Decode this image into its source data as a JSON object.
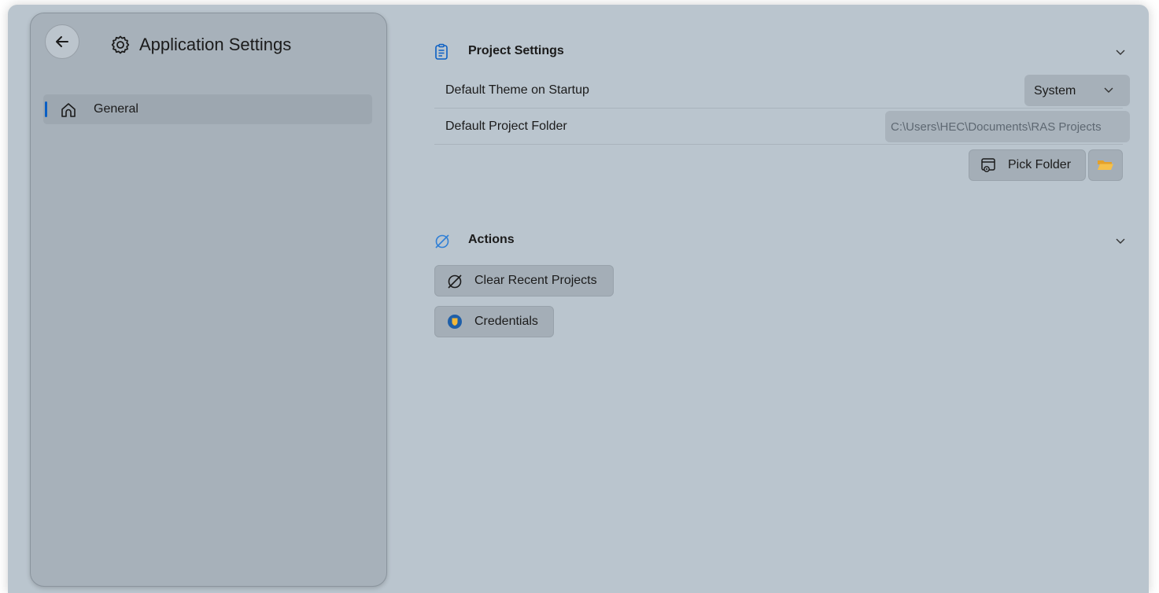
{
  "sidebar": {
    "title": "Application Settings",
    "items": [
      {
        "label": "General",
        "icon": "home-icon",
        "selected": true
      }
    ]
  },
  "project_settings": {
    "title": "Project Settings",
    "theme_label": "Default Theme on Startup",
    "theme_value": "System",
    "folder_label": "Default Project Folder",
    "folder_value": "C:\\Users\\HEC\\Documents\\RAS Projects",
    "pick_folder_label": "Pick Folder"
  },
  "actions": {
    "title": "Actions",
    "clear_recent_label": "Clear Recent Projects",
    "credentials_label": "Credentials"
  },
  "colors": {
    "accent": "#0a5fc4",
    "window_bg": "#bac5ce",
    "sidebar_bg": "#a7b1ba",
    "folder_yellow": "#f2b83a"
  }
}
